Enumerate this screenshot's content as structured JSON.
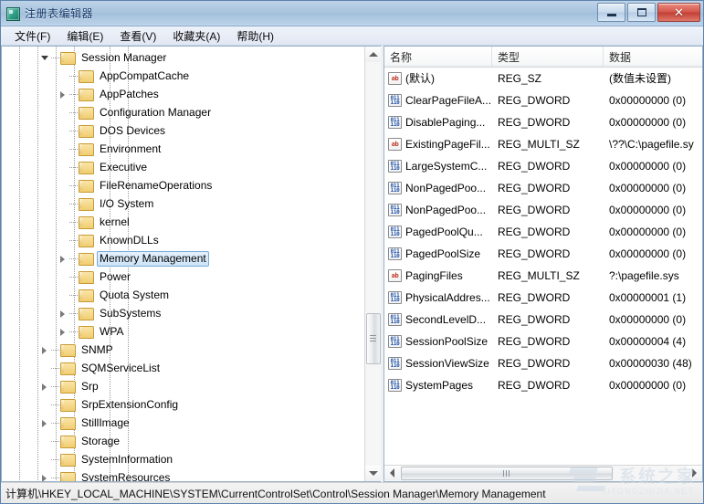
{
  "window": {
    "title": "注册表编辑器",
    "icon": "registry-editor-icon",
    "controls": {
      "minimize_label": "–",
      "maximize_label": "□",
      "close_label": "✕"
    }
  },
  "menubar": {
    "items": [
      {
        "label": "文件(F)"
      },
      {
        "label": "编辑(E)"
      },
      {
        "label": "查看(V)"
      },
      {
        "label": "收藏夹(A)"
      },
      {
        "label": "帮助(H)"
      }
    ]
  },
  "tree": {
    "nodes": [
      {
        "label": "Session Manager",
        "indent": 3,
        "twist": "open",
        "selected": false
      },
      {
        "label": "AppCompatCache",
        "indent": 4,
        "twist": "none",
        "selected": false
      },
      {
        "label": "AppPatches",
        "indent": 4,
        "twist": "closed",
        "selected": false
      },
      {
        "label": "Configuration Manager",
        "indent": 4,
        "twist": "none",
        "selected": false
      },
      {
        "label": "DOS Devices",
        "indent": 4,
        "twist": "none",
        "selected": false
      },
      {
        "label": "Environment",
        "indent": 4,
        "twist": "none",
        "selected": false
      },
      {
        "label": "Executive",
        "indent": 4,
        "twist": "none",
        "selected": false
      },
      {
        "label": "FileRenameOperations",
        "indent": 4,
        "twist": "none",
        "selected": false
      },
      {
        "label": "I/O System",
        "indent": 4,
        "twist": "none",
        "selected": false
      },
      {
        "label": "kernel",
        "indent": 4,
        "twist": "none",
        "selected": false
      },
      {
        "label": "KnownDLLs",
        "indent": 4,
        "twist": "none",
        "selected": false
      },
      {
        "label": "Memory Management",
        "indent": 4,
        "twist": "closed",
        "selected": true
      },
      {
        "label": "Power",
        "indent": 4,
        "twist": "none",
        "selected": false
      },
      {
        "label": "Quota System",
        "indent": 4,
        "twist": "none",
        "selected": false
      },
      {
        "label": "SubSystems",
        "indent": 4,
        "twist": "closed",
        "selected": false
      },
      {
        "label": "WPA",
        "indent": 4,
        "twist": "closed",
        "selected": false
      },
      {
        "label": "SNMP",
        "indent": 3,
        "twist": "closed",
        "selected": false
      },
      {
        "label": "SQMServiceList",
        "indent": 3,
        "twist": "none",
        "selected": false
      },
      {
        "label": "Srp",
        "indent": 3,
        "twist": "closed",
        "selected": false
      },
      {
        "label": "SrpExtensionConfig",
        "indent": 3,
        "twist": "none",
        "selected": false
      },
      {
        "label": "StillImage",
        "indent": 3,
        "twist": "closed",
        "selected": false
      },
      {
        "label": "Storage",
        "indent": 3,
        "twist": "none",
        "selected": false
      },
      {
        "label": "SystemInformation",
        "indent": 3,
        "twist": "none",
        "selected": false
      },
      {
        "label": "SystemResources",
        "indent": 3,
        "twist": "closed",
        "selected": false
      }
    ]
  },
  "list": {
    "columns": [
      {
        "label": "名称"
      },
      {
        "label": "类型"
      },
      {
        "label": "数据"
      }
    ],
    "rows": [
      {
        "name": "(默认)",
        "type": "REG_SZ",
        "data": "(数值未设置)",
        "icon": "string-value-icon"
      },
      {
        "name": "ClearPageFileA...",
        "type": "REG_DWORD",
        "data": "0x00000000 (0)",
        "icon": "dword-value-icon"
      },
      {
        "name": "DisablePaging...",
        "type": "REG_DWORD",
        "data": "0x00000000 (0)",
        "icon": "dword-value-icon"
      },
      {
        "name": "ExistingPageFil...",
        "type": "REG_MULTI_SZ",
        "data": "\\??\\C:\\pagefile.sy",
        "icon": "string-value-icon"
      },
      {
        "name": "LargeSystemC...",
        "type": "REG_DWORD",
        "data": "0x00000000 (0)",
        "icon": "dword-value-icon"
      },
      {
        "name": "NonPagedPoo...",
        "type": "REG_DWORD",
        "data": "0x00000000 (0)",
        "icon": "dword-value-icon"
      },
      {
        "name": "NonPagedPoo...",
        "type": "REG_DWORD",
        "data": "0x00000000 (0)",
        "icon": "dword-value-icon"
      },
      {
        "name": "PagedPoolQu...",
        "type": "REG_DWORD",
        "data": "0x00000000 (0)",
        "icon": "dword-value-icon"
      },
      {
        "name": "PagedPoolSize",
        "type": "REG_DWORD",
        "data": "0x00000000 (0)",
        "icon": "dword-value-icon"
      },
      {
        "name": "PagingFiles",
        "type": "REG_MULTI_SZ",
        "data": "?:\\pagefile.sys",
        "icon": "string-value-icon"
      },
      {
        "name": "PhysicalAddres...",
        "type": "REG_DWORD",
        "data": "0x00000001 (1)",
        "icon": "dword-value-icon"
      },
      {
        "name": "SecondLevelD...",
        "type": "REG_DWORD",
        "data": "0x00000000 (0)",
        "icon": "dword-value-icon"
      },
      {
        "name": "SessionPoolSize",
        "type": "REG_DWORD",
        "data": "0x00000004 (4)",
        "icon": "dword-value-icon"
      },
      {
        "name": "SessionViewSize",
        "type": "REG_DWORD",
        "data": "0x00000030 (48)",
        "icon": "dword-value-icon"
      },
      {
        "name": "SystemPages",
        "type": "REG_DWORD",
        "data": "0x00000000 (0)",
        "icon": "dword-value-icon"
      }
    ]
  },
  "statusbar": {
    "path": "计算机\\HKEY_LOCAL_MACHINE\\SYSTEM\\CurrentControlSet\\Control\\Session Manager\\Memory Management"
  },
  "watermark": {
    "cn": "系统之家",
    "en": "XITONGZHIJIA.NET"
  },
  "colors": {
    "title_accent": "#a9c4de",
    "selection": "#cce4f8",
    "close_button": "#c23f34",
    "folder": "#f0cd72",
    "string_icon": "#c0392b",
    "dword_icon": "#1f4fa3"
  }
}
